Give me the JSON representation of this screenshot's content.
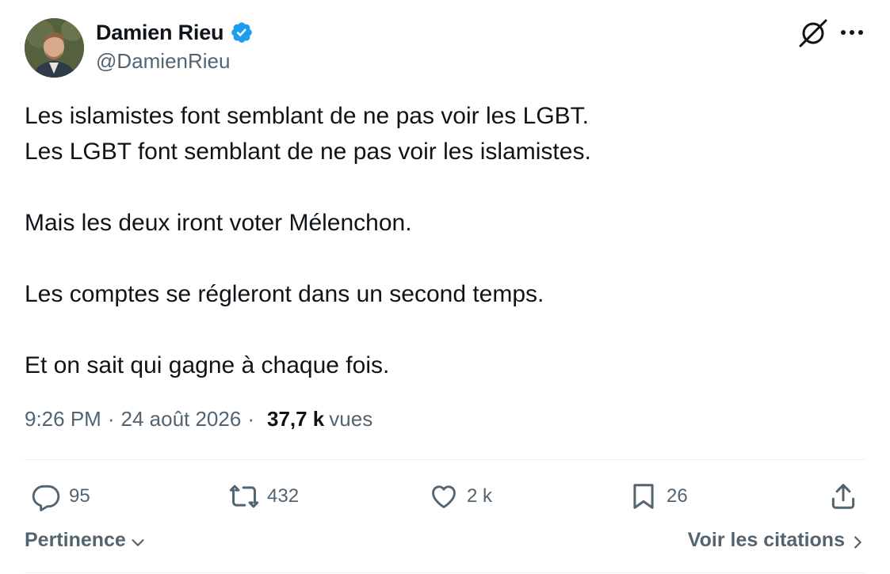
{
  "author": {
    "display_name": "Damien Rieu",
    "handle": "@DamienRieu",
    "verified": true,
    "verified_color": "#1d9bf0"
  },
  "tweet": {
    "lines": [
      "Les islamistes font semblant de ne pas voir les LGBT.",
      "Les LGBT font semblant de ne pas voir les islamistes.",
      "",
      "Mais les deux iront voter Mélenchon.",
      "",
      "Les comptes se régleront dans un second temps.",
      "",
      "Et on sait qui gagne à chaque fois."
    ]
  },
  "meta": {
    "time": "9:26 PM",
    "separator": "·",
    "date": "24 août 2026",
    "views_count": "37,7 k",
    "views_label": "vues"
  },
  "actions": {
    "replies": "95",
    "reposts": "432",
    "likes": "2 k",
    "bookmarks": "26"
  },
  "footer": {
    "sort_label": "Pertinence",
    "quotes_label": "Voir les citations"
  },
  "icons": {
    "top_right": [
      "grok-icon",
      "more-icon"
    ],
    "actions": [
      "reply-icon",
      "repost-icon",
      "like-icon",
      "bookmark-icon",
      "share-icon"
    ]
  },
  "colors": {
    "text": "#0f1419",
    "secondary": "#536471",
    "divider": "#eff3f4"
  }
}
